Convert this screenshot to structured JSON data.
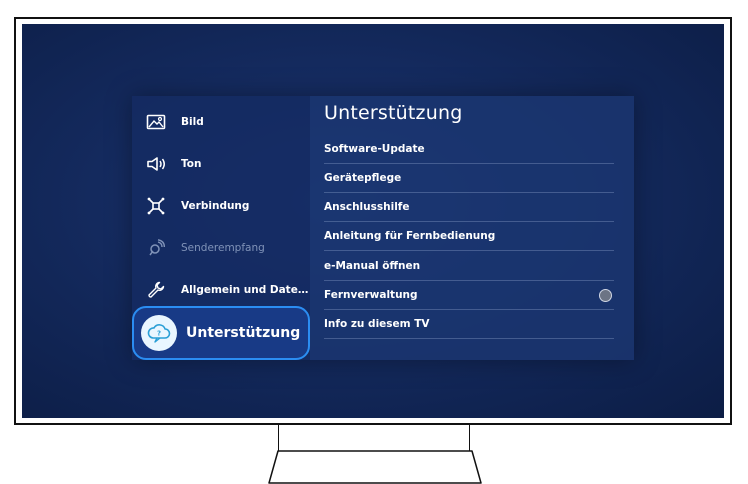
{
  "menu": {
    "nav_items": [
      {
        "label": "Bild",
        "icon": "picture-icon",
        "state": "normal"
      },
      {
        "label": "Ton",
        "icon": "speaker-icon",
        "state": "normal"
      },
      {
        "label": "Verbindung",
        "icon": "network-icon",
        "state": "normal"
      },
      {
        "label": "Senderempfang",
        "icon": "broadcast-icon",
        "state": "disabled"
      },
      {
        "label": "Allgemein und Date…",
        "icon": "wrench-icon",
        "state": "normal"
      },
      {
        "label": "Unterstützung",
        "icon": "cloud-support-icon",
        "state": "selected"
      }
    ]
  },
  "support": {
    "title": "Unterstützung",
    "options": [
      {
        "label": "Software-Update"
      },
      {
        "label": "Gerätepflege"
      },
      {
        "label": "Anschlusshilfe"
      },
      {
        "label": "Anleitung für Fernbedienung"
      },
      {
        "label": "e-Manual öffnen"
      },
      {
        "label": "Fernverwaltung",
        "toggle": "off"
      },
      {
        "label": "Info zu diesem TV"
      }
    ]
  },
  "colors": {
    "screen_bg": "#142a5e",
    "focus_border": "#2b8df2",
    "text": "#ffffff",
    "disabled_text": "#8093b8"
  }
}
